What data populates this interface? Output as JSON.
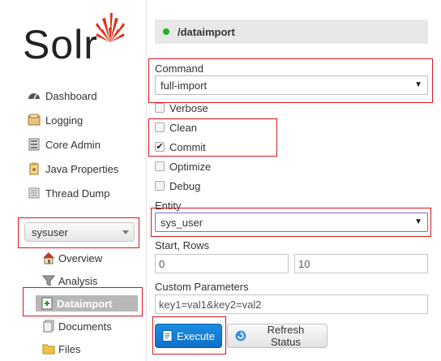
{
  "logo": {
    "text": "Solr"
  },
  "sidebar": {
    "items": [
      {
        "label": "Dashboard",
        "icon": "dashboard-icon"
      },
      {
        "label": "Logging",
        "icon": "logging-icon"
      },
      {
        "label": "Core Admin",
        "icon": "core-admin-icon"
      },
      {
        "label": "Java Properties",
        "icon": "java-properties-icon"
      },
      {
        "label": "Thread Dump",
        "icon": "thread-dump-icon"
      }
    ],
    "core_selector": {
      "value": "sysuser"
    },
    "core_items": [
      {
        "label": "Overview",
        "icon": "home-icon"
      },
      {
        "label": "Analysis",
        "icon": "funnel-icon"
      },
      {
        "label": "Dataimport",
        "icon": "dataimport-icon",
        "active": true
      },
      {
        "label": "Documents",
        "icon": "documents-icon"
      },
      {
        "label": "Files",
        "icon": "folder-icon"
      }
    ]
  },
  "main": {
    "header": {
      "title": "/dataimport",
      "status_color": "#1fb319"
    },
    "command": {
      "label": "Command",
      "value": "full-import"
    },
    "options": [
      {
        "label": "Verbose",
        "checked": false
      },
      {
        "label": "Clean",
        "checked": false
      },
      {
        "label": "Commit",
        "checked": true
      },
      {
        "label": "Optimize",
        "checked": false
      },
      {
        "label": "Debug",
        "checked": false
      }
    ],
    "entity": {
      "label": "Entity",
      "value": "sys_user"
    },
    "start_rows": {
      "label": "Start, Rows",
      "start_value": "0",
      "rows_value": "10"
    },
    "custom_params": {
      "label": "Custom Parameters",
      "value": "key1=val1&key2=val2"
    },
    "buttons": {
      "execute": "Execute",
      "refresh": "Refresh Status"
    }
  },
  "colors": {
    "highlight": "#d9161e",
    "execute": "#1a8fe3",
    "active_nav": "#b7b7b7"
  }
}
